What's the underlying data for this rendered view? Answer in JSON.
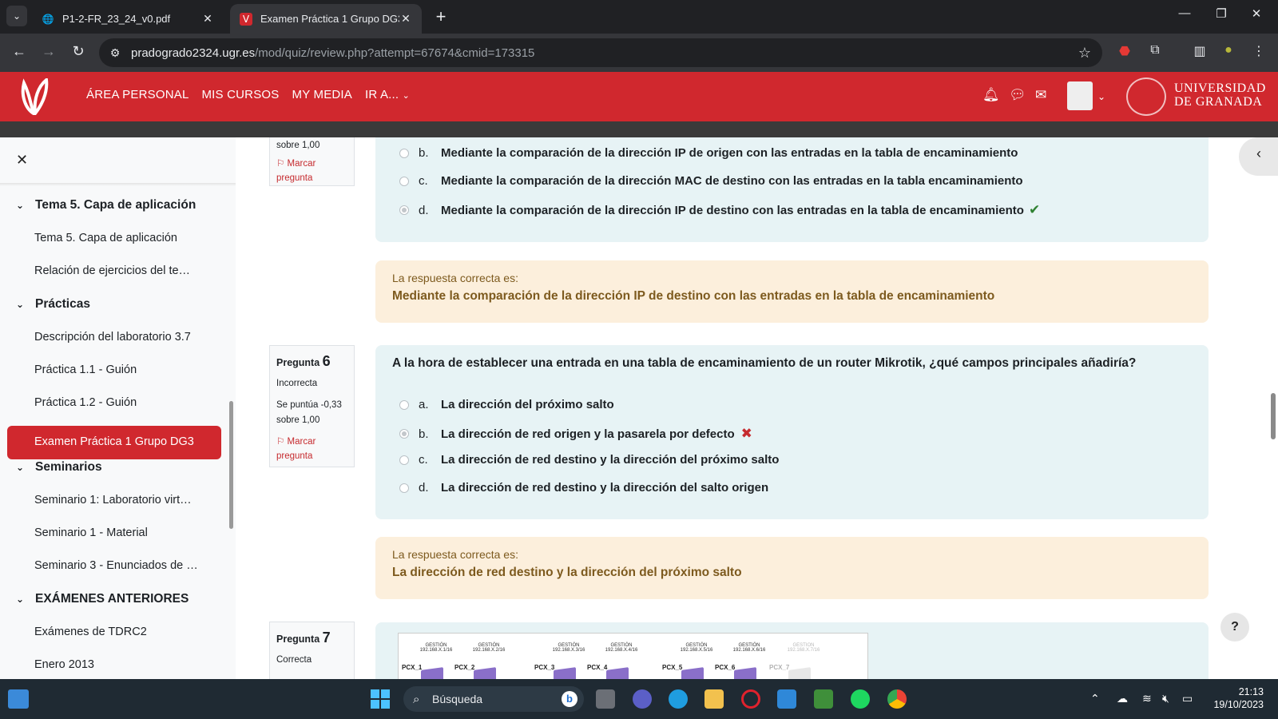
{
  "browser": {
    "tabs": [
      {
        "title": "P1-2-FR_23_24_v0.pdf",
        "active": false
      },
      {
        "title": "Examen Práctica 1 Grupo DG3:",
        "active": true
      }
    ],
    "url_host": "pradogrado2324.ugr.es",
    "url_path": "/mod/quiz/review.php?attempt=67674&cmid=173315"
  },
  "site": {
    "nav": [
      "ÁREA PERSONAL",
      "MIS CURSOS",
      "MY MEDIA",
      "IR A..."
    ],
    "university_line1": "UNIVERSIDAD",
    "university_line2": "DE GRANADA",
    "brand_color": "#d0282e"
  },
  "sidebar": {
    "items": [
      {
        "type": "section",
        "label": "Tema 5. Capa de aplicación"
      },
      {
        "type": "item",
        "label": "Tema 5. Capa de aplicación"
      },
      {
        "type": "item",
        "label": "Relación de ejercicios del te…"
      },
      {
        "type": "section",
        "label": "Prácticas"
      },
      {
        "type": "item",
        "label": "Descripción del laboratorio 3.7"
      },
      {
        "type": "item",
        "label": "Práctica 1.1 - Guión"
      },
      {
        "type": "item",
        "label": "Práctica 1.2 - Guión"
      },
      {
        "type": "active",
        "label": "Examen Práctica 1 Grupo DG3"
      },
      {
        "type": "section",
        "label": "Seminarios"
      },
      {
        "type": "item",
        "label": "Seminario 1: Laboratorio virt…"
      },
      {
        "type": "item",
        "label": "Seminario 1 - Material"
      },
      {
        "type": "item",
        "label": "Seminario 3 - Enunciados de …"
      },
      {
        "type": "section",
        "label": "EXÁMENES ANTERIORES"
      },
      {
        "type": "item",
        "label": "Exámenes de TDRC2"
      },
      {
        "type": "item",
        "label": "Enero 2013"
      }
    ]
  },
  "q5": {
    "score_tail": "sobre 1,00",
    "flag": "Marcar pregunta",
    "options": [
      {
        "letter": "b.",
        "text": "Mediante la comparación de la dirección IP de origen con las entradas en la tabla de encaminamiento",
        "checked": false
      },
      {
        "letter": "c.",
        "text": "Mediante la comparación de la dirección MAC de destino con las entradas en la tabla encaminamiento",
        "checked": false
      },
      {
        "letter": "d.",
        "text": "Mediante la comparación de la dirección IP de destino con las entradas en la tabla de encaminamiento",
        "checked": true
      }
    ],
    "correct_label": "La respuesta correcta es:",
    "correct_answer": "Mediante la comparación de la dirección IP de destino con las entradas en la tabla de encaminamiento"
  },
  "q6": {
    "label": "Pregunta",
    "number": "6",
    "state": "Incorrecta",
    "score": "Se puntúa -0,33 sobre 1,00",
    "flag": "Marcar pregunta",
    "question": "A la hora de establecer una entrada en una tabla de encaminamiento de un router Mikrotik, ¿qué campos principales añadiría?",
    "options": [
      {
        "letter": "a.",
        "text": "La dirección del próximo salto",
        "checked": false
      },
      {
        "letter": "b.",
        "text": "La dirección de red origen y la pasarela por defecto",
        "checked": true
      },
      {
        "letter": "c.",
        "text": "La dirección de red destino y la dirección del próximo salto",
        "checked": false
      },
      {
        "letter": "d.",
        "text": "La dirección de red destino y la dirección del salto origen",
        "checked": false
      }
    ],
    "correct_label": "La respuesta correcta es:",
    "correct_answer": "La dirección de red destino y la dirección del próximo salto"
  },
  "q7": {
    "label": "Pregunta",
    "number": "7",
    "state": "Correcta",
    "diagram_pcs": [
      "PCX_1",
      "PCX_2",
      "PCX_3",
      "PCX_4",
      "PCX_5",
      "PCX_6",
      "PCX_7"
    ],
    "diagram_gestion": [
      "GESTIÓN 192.168.X.1/16",
      "GESTIÓN 192.168.X.2/16",
      "GESTIÓN 192.168.X.3/16",
      "GESTIÓN 192.168.X.4/16",
      "GESTIÓN 192.168.X.5/16",
      "GESTIÓN 192.168.X.6/16",
      "GESTIÓN 192.168.X.7/16"
    ]
  },
  "taskbar": {
    "search_placeholder": "Búsqueda",
    "time": "21:13",
    "date": "19/10/2023"
  }
}
